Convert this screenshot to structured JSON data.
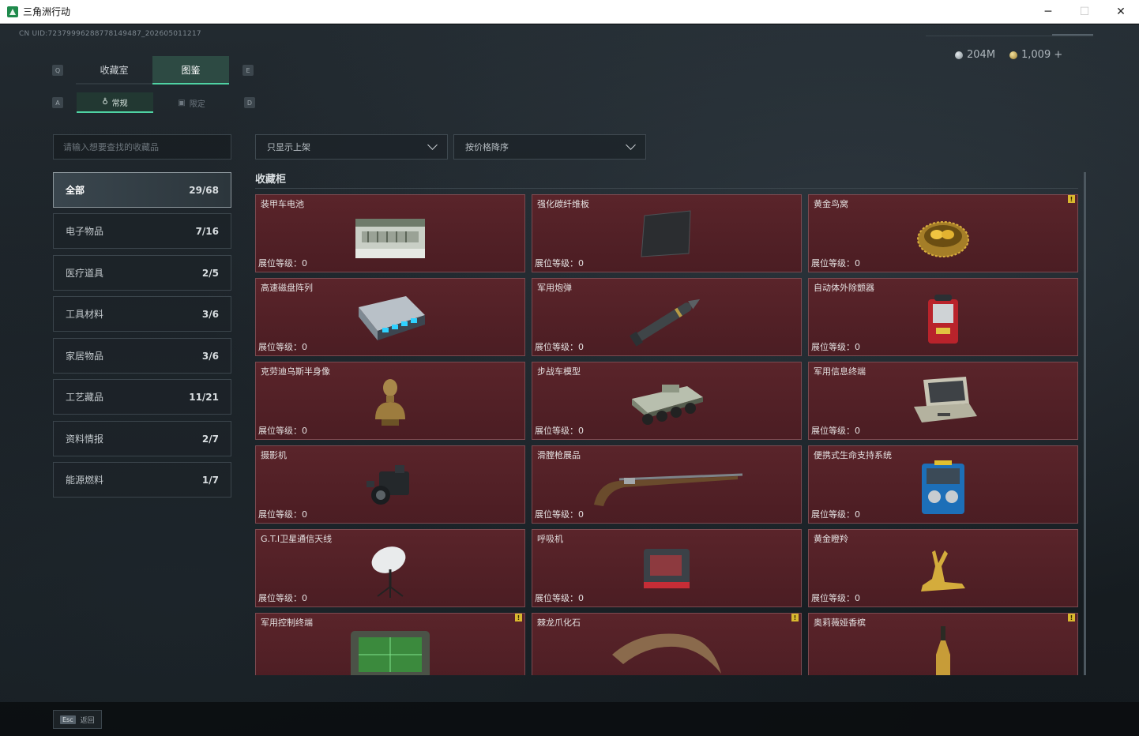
{
  "window": {
    "title": "三角洲行动",
    "minimize": "─",
    "maximize": "☐",
    "close": "✕"
  },
  "header": {
    "uid": "CN UID:7237999628877814948​7_202605011217",
    "silver": "204M",
    "gold": "1,009 +"
  },
  "keys": {
    "q": "Q",
    "e": "E",
    "a": "A",
    "d": "D"
  },
  "tabs": [
    "收藏室",
    "图鉴"
  ],
  "subtabs": [
    {
      "icon": "♁",
      "label": "常规"
    },
    {
      "icon": "▣",
      "label": "限定"
    }
  ],
  "search": {
    "placeholder": "请输入想要查找的收藏品"
  },
  "categories": [
    {
      "label": "全部",
      "count": "29/68"
    },
    {
      "label": "电子物品",
      "count": "7/16"
    },
    {
      "label": "医疗道具",
      "count": "2/5"
    },
    {
      "label": "工具材料",
      "count": "3/6"
    },
    {
      "label": "家居物品",
      "count": "3/6"
    },
    {
      "label": "工艺藏品",
      "count": "11/21"
    },
    {
      "label": "资料情报",
      "count": "2/7"
    },
    {
      "label": "能源燃料",
      "count": "1/7"
    }
  ],
  "filters": {
    "shelf": "只显示上架",
    "sort": "按价格降序"
  },
  "section_title": "收藏柜",
  "level_label": "展位等级：",
  "items": [
    {
      "name": "装甲车电池",
      "level": "0",
      "badge": "",
      "icon": "battery-icon"
    },
    {
      "name": "强化碳纤维板",
      "level": "0",
      "badge": "",
      "icon": "carbon-plate-icon"
    },
    {
      "name": "黄金鸟窝",
      "level": "0",
      "badge": "!",
      "icon": "golden-nest-icon"
    },
    {
      "name": "高速磁盘阵列",
      "level": "0",
      "badge": "",
      "icon": "disk-array-icon"
    },
    {
      "name": "军用炮弹",
      "level": "0",
      "badge": "",
      "icon": "shell-icon"
    },
    {
      "name": "自动体外除颤器",
      "level": "0",
      "badge": "",
      "icon": "defibrillator-icon"
    },
    {
      "name": "克劳迪乌斯半身像",
      "level": "0",
      "badge": "",
      "icon": "bust-icon"
    },
    {
      "name": "步战车模型",
      "level": "0",
      "badge": "",
      "icon": "ifv-model-icon"
    },
    {
      "name": "军用信息终端",
      "level": "0",
      "badge": "",
      "icon": "rugged-laptop-icon"
    },
    {
      "name": "摄影机",
      "level": "0",
      "badge": "",
      "icon": "camera-icon"
    },
    {
      "name": "滑膛枪展品",
      "level": "0",
      "badge": "",
      "icon": "musket-icon"
    },
    {
      "name": "便携式生命支持系统",
      "level": "0",
      "badge": "",
      "icon": "life-support-icon"
    },
    {
      "name": "G.T.I卫星通信天线",
      "level": "0",
      "badge": "",
      "icon": "satellite-dish-icon"
    },
    {
      "name": "呼吸机",
      "level": "0",
      "badge": "",
      "icon": "ventilator-icon"
    },
    {
      "name": "黄金瞪羚",
      "level": "0",
      "badge": "",
      "icon": "golden-gazelle-icon"
    },
    {
      "name": "军用控制终端",
      "level": "",
      "badge": "!",
      "icon": "control-terminal-icon"
    },
    {
      "name": "棘龙爪化石",
      "level": "",
      "badge": "!",
      "icon": "claw-fossil-icon"
    },
    {
      "name": "奥莉薇娅香槟",
      "level": "",
      "badge": "!",
      "icon": "champagne-icon"
    }
  ],
  "footer": {
    "esc_key": "Esc",
    "back": "返回"
  }
}
